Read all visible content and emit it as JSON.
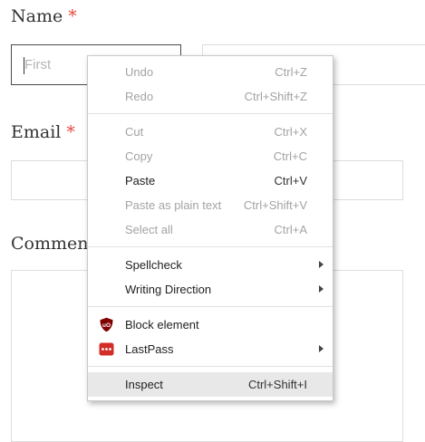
{
  "form": {
    "name_label": "Name",
    "required_mark": "*",
    "first_placeholder": "First",
    "email_label": "Email",
    "comment_label": "Comment"
  },
  "context_menu": {
    "undo": {
      "label": "Undo",
      "shortcut": "Ctrl+Z",
      "enabled": false
    },
    "redo": {
      "label": "Redo",
      "shortcut": "Ctrl+Shift+Z",
      "enabled": false
    },
    "cut": {
      "label": "Cut",
      "shortcut": "Ctrl+X",
      "enabled": false
    },
    "copy": {
      "label": "Copy",
      "shortcut": "Ctrl+C",
      "enabled": false
    },
    "paste": {
      "label": "Paste",
      "shortcut": "Ctrl+V",
      "enabled": true
    },
    "paste_plain": {
      "label": "Paste as plain text",
      "shortcut": "Ctrl+Shift+V",
      "enabled": false
    },
    "select_all": {
      "label": "Select all",
      "shortcut": "Ctrl+A",
      "enabled": false
    },
    "spellcheck": {
      "label": "Spellcheck",
      "submenu": true
    },
    "writing_direction": {
      "label": "Writing Direction",
      "submenu": true
    },
    "block_element": {
      "label": "Block element",
      "icon": "ublock-origin-icon"
    },
    "lastpass": {
      "label": "LastPass",
      "icon": "lastpass-icon",
      "submenu": true
    },
    "inspect": {
      "label": "Inspect",
      "shortcut": "Ctrl+Shift+I",
      "highlighted": true
    }
  },
  "colors": {
    "required": "#e4473c",
    "ublock_red": "#800000",
    "lastpass_red": "#d32d27"
  }
}
